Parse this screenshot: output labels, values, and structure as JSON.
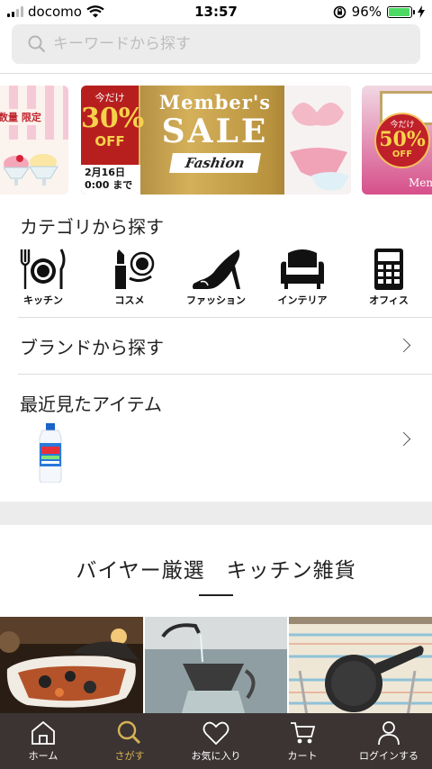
{
  "status_bar": {
    "carrier": "docomo",
    "time": "13:57",
    "battery": "96%",
    "battery_level": 0.96
  },
  "search": {
    "placeholder": "キーワードから探す"
  },
  "banners": {
    "left": {
      "tag": "数量 限定"
    },
    "main": {
      "small": "今だけ",
      "percent": "30%",
      "off": "OFF",
      "date_line1": "2月16日",
      "date_line2": "0:00 まで",
      "member": "Member's",
      "sale": "SALE",
      "fashion": "Fashion"
    },
    "right": {
      "small": "今だけ",
      "percent": "50%",
      "off": "OFF",
      "member": "Mem"
    }
  },
  "categories": {
    "title": "カテゴリから探す",
    "items": [
      {
        "label": "キッチン",
        "icon": "kitchen-icon"
      },
      {
        "label": "コスメ",
        "icon": "cosme-icon"
      },
      {
        "label": "ファッション",
        "icon": "fashion-icon"
      },
      {
        "label": "インテリア",
        "icon": "interior-icon"
      },
      {
        "label": "オフィス",
        "icon": "office-icon"
      }
    ]
  },
  "brand": {
    "title": "ブランドから探す"
  },
  "recent": {
    "title": "最近見たアイテム"
  },
  "feature": {
    "title": "バイヤー厳選　キッチン雑貨"
  },
  "tabbar": {
    "items": [
      {
        "label": "ホーム",
        "icon": "home-icon",
        "active": false
      },
      {
        "label": "さがす",
        "icon": "search-icon",
        "active": true
      },
      {
        "label": "お気に入り",
        "icon": "heart-icon",
        "active": false
      },
      {
        "label": "カート",
        "icon": "cart-icon",
        "active": false
      },
      {
        "label": "ログインする",
        "icon": "user-icon",
        "active": false
      }
    ]
  },
  "colors": {
    "tabbar_bg": "#3b3433",
    "active": "#d7b254",
    "search_bg": "#ececec"
  }
}
